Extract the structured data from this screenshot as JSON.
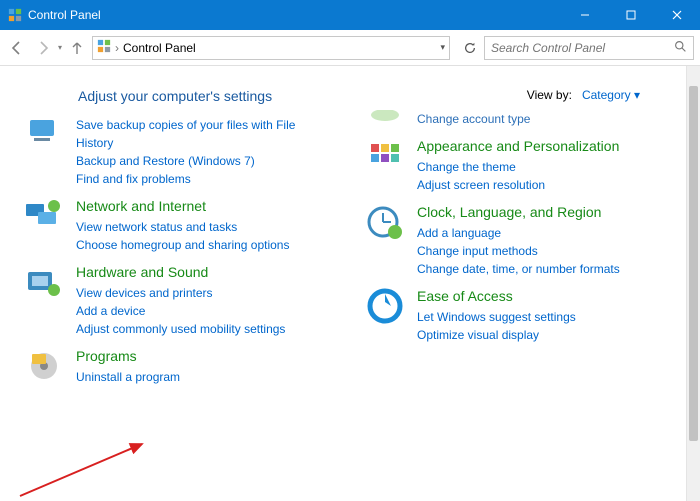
{
  "window": {
    "title": "Control Panel"
  },
  "addressbar": {
    "location": "Control Panel"
  },
  "search": {
    "placeholder": "Search Control Panel"
  },
  "heading": "Adjust your computer's settings",
  "viewby": {
    "label": "View by:",
    "value": "Category"
  },
  "left": {
    "trunc": "Change account type",
    "cat0": {
      "links": {
        "0": "Save backup copies of your files with File History",
        "1": "Backup and Restore (Windows 7)",
        "2": "Find and fix problems"
      }
    },
    "cat1": {
      "title": "Network and Internet",
      "links": {
        "0": "View network status and tasks",
        "1": "Choose homegroup and sharing options"
      }
    },
    "cat2": {
      "title": "Hardware and Sound",
      "links": {
        "0": "View devices and printers",
        "1": "Add a device",
        "2": "Adjust commonly used mobility settings"
      }
    },
    "cat3": {
      "title": "Programs",
      "links": {
        "0": "Uninstall a program"
      }
    }
  },
  "right": {
    "cat0": {
      "title": "Appearance and Personalization",
      "links": {
        "0": "Change the theme",
        "1": "Adjust screen resolution"
      }
    },
    "cat1": {
      "title": "Clock, Language, and Region",
      "links": {
        "0": "Add a language",
        "1": "Change input methods",
        "2": "Change date, time, or number formats"
      }
    },
    "cat2": {
      "title": "Ease of Access",
      "links": {
        "0": "Let Windows suggest settings",
        "1": "Optimize visual display"
      }
    }
  }
}
